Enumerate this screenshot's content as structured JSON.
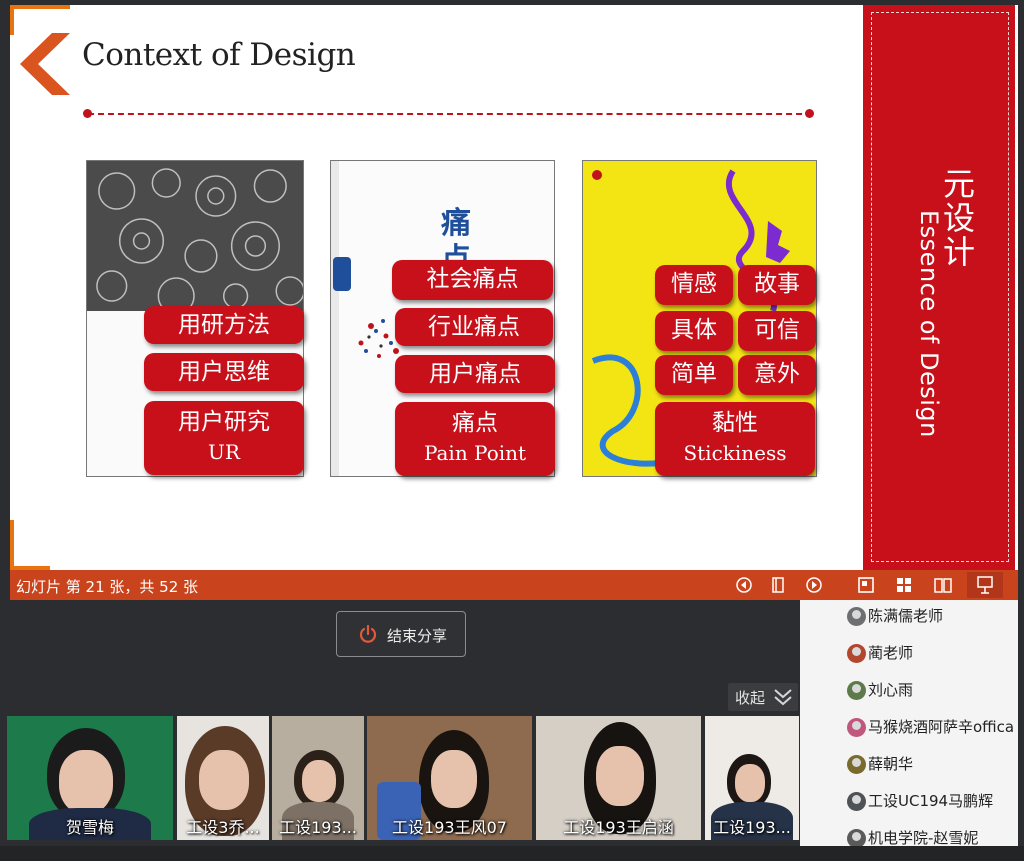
{
  "slide": {
    "title": "Context of Design",
    "books": [
      {
        "pills": [
          {
            "text": "用研方法"
          },
          {
            "text": "用户思维"
          },
          {
            "text": "用户研究",
            "en": "UR"
          }
        ]
      },
      {
        "pills": [
          {
            "text": "社会痛点"
          },
          {
            "text": "行业痛点"
          },
          {
            "text": "用户痛点"
          },
          {
            "text": "痛点",
            "en": "Pain Point"
          }
        ]
      },
      {
        "pills": [
          {
            "text": "情感"
          },
          {
            "text": "故事"
          },
          {
            "text": "具体"
          },
          {
            "text": "可信"
          },
          {
            "text": "简单"
          },
          {
            "text": "意外"
          },
          {
            "text": "黏性",
            "en": "Stickiness"
          }
        ]
      }
    ],
    "side_panel": {
      "title_cn": "元设计",
      "title_en": "Essence of Design"
    },
    "colors": {
      "accent": "#c8101b",
      "corner": "#e8730f",
      "statusbar": "#c9431d"
    }
  },
  "statusbar": {
    "slide_counter": "幻灯片 第 21 张，共 52 张",
    "buttons": [
      "prev-icon",
      "notes-icon",
      "next-icon",
      "normal-view-icon",
      "grid-view-icon",
      "reading-view-icon",
      "presenter-view-icon"
    ]
  },
  "meeting": {
    "stop_share_label": "结束分享",
    "collapse_label": "收起",
    "participants": [
      {
        "name": "陈满儒老师"
      },
      {
        "name": "蔺老师"
      },
      {
        "name": "刘心雨"
      },
      {
        "name": "马猴烧酒阿萨辛offica"
      },
      {
        "name": "薛朝华"
      },
      {
        "name": "工设UC194马鹏辉"
      },
      {
        "name": "机电学院-赵雪妮"
      }
    ],
    "videos": [
      {
        "name": "贺雪梅"
      },
      {
        "name": "工设3乔..."
      },
      {
        "name": "工设193..."
      },
      {
        "name": "工设193王风07"
      },
      {
        "name": "工设193王启涵"
      },
      {
        "name": "工设193..."
      }
    ]
  }
}
